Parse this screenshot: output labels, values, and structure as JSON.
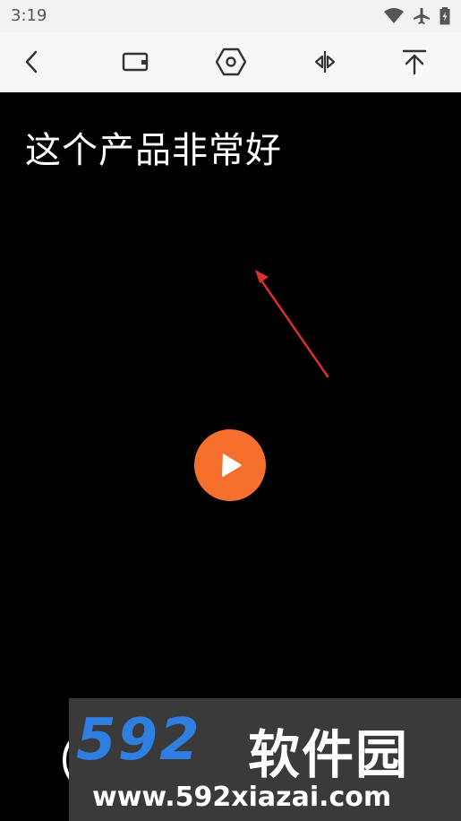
{
  "status_bar": {
    "time": "3:19",
    "icons": [
      "wifi-icon",
      "airplane-icon",
      "battery-icon"
    ]
  },
  "toolbar": {
    "buttons": [
      "back-icon",
      "window-icon",
      "settings-hexagon-icon",
      "mirror-flip-icon",
      "pin-to-top-icon"
    ]
  },
  "video": {
    "caption": "这个产品非常好",
    "play_color": "#f5702d",
    "arrow_color": "#e8322a"
  },
  "watermark": {
    "logo_number": "592",
    "logo_text": "软件园",
    "url": "www.592xiazai.com",
    "brand_color": "#2f7fe0"
  }
}
